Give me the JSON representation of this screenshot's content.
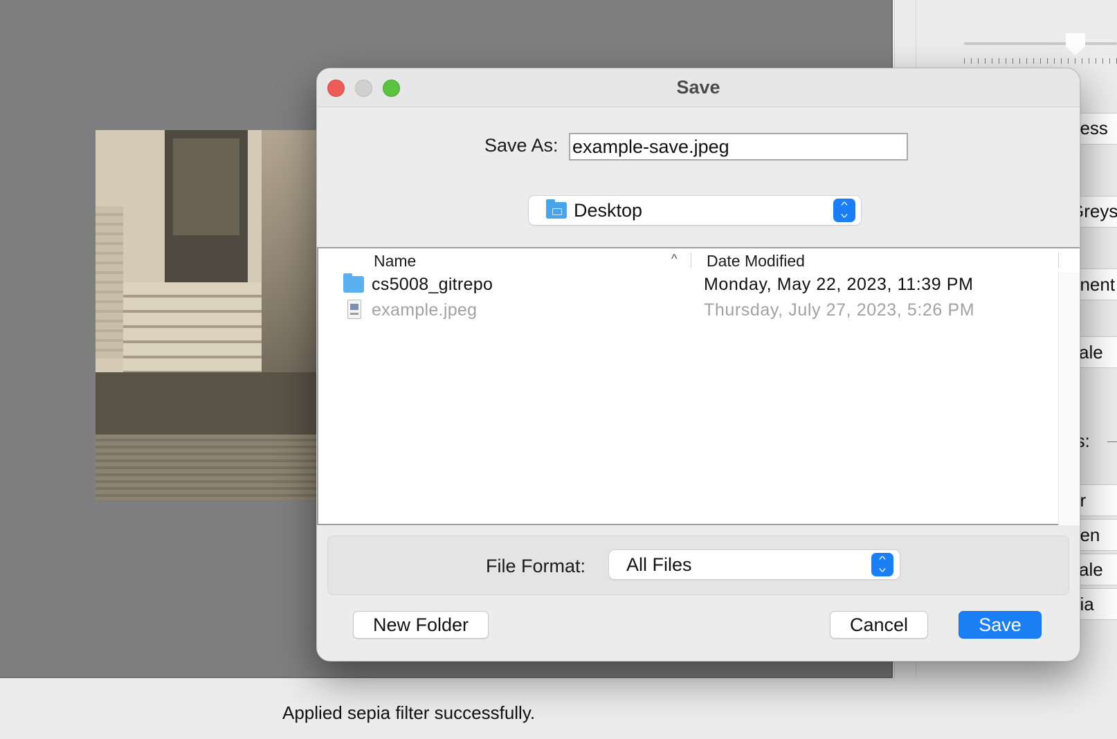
{
  "app": {
    "status_message": "Applied sepia filter successfully.",
    "side_panel_labels": [
      "ness",
      "Greys",
      "onent",
      "cale",
      "rs:",
      "ur",
      "pen",
      "cale",
      "pia"
    ]
  },
  "dialog": {
    "title": "Save",
    "save_as_label": "Save As:",
    "save_as_value": "example-save.jpeg",
    "location": {
      "selected": "Desktop",
      "icon": "folder-icon"
    },
    "file_list": {
      "columns": [
        "Name",
        "Date Modified"
      ],
      "sort_indicator": "^",
      "rows": [
        {
          "name": "cs5008_gitrepo",
          "date_modified": "Monday, May 22, 2023, 11:39 PM",
          "kind": "folder",
          "enabled": true
        },
        {
          "name": "example.jpeg",
          "date_modified": "Thursday, July 27, 2023, 5:26 PM",
          "kind": "jpeg",
          "enabled": false
        }
      ]
    },
    "file_format": {
      "label": "File Format:",
      "selected": "All Files"
    },
    "buttons": {
      "new_folder": "New Folder",
      "cancel": "Cancel",
      "save": "Save"
    }
  },
  "colors": {
    "accent": "#1a7ef5",
    "close": "#ee5d55",
    "minimize": "#d0d0d0",
    "zoom": "#5bc340",
    "folder": "#5bb1ee"
  }
}
